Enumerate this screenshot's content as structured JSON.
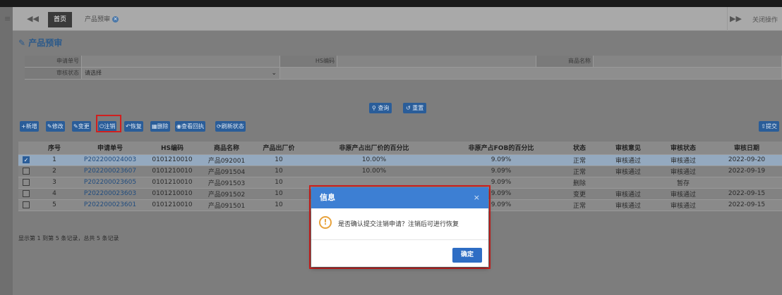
{
  "tabs": {
    "home": "首页",
    "active": "产品预审",
    "close_ops": "关闭操作"
  },
  "page": {
    "title": "产品预审"
  },
  "form": {
    "apply_no_label": "申请单号",
    "hs_label": "HS编码",
    "goods_name_label": "商品名称",
    "status_label": "审核状态",
    "status_value": "请选择",
    "query": "查询",
    "reset": "重置"
  },
  "toolbar": {
    "add": "新增",
    "edit": "修改",
    "change": "变更",
    "cancel": "注销",
    "restore": "恢复",
    "delete": "删除",
    "view_receipt": "查看回执",
    "refresh": "刷新状态",
    "submit": "提交"
  },
  "table": {
    "columns": [
      "序号",
      "申请单号",
      "HS编码",
      "商品名称",
      "产品出厂价",
      "非原产占出厂价的百分比",
      "非原产占FOB的百分比",
      "状态",
      "审核意见",
      "审核状态",
      "审核日期"
    ],
    "rows": [
      {
        "no": "1",
        "apply": "P202200024003",
        "hs": "0101210010",
        "name": "产品092001",
        "price": "10",
        "pct_ex": "10.00%",
        "pct_fob": "9.09%",
        "state": "正常",
        "opinion": "审核通过",
        "audit": "审核通过",
        "date": "2022-09-20",
        "checked": true
      },
      {
        "no": "2",
        "apply": "P202200023607",
        "hs": "0101210010",
        "name": "产品091504",
        "price": "10",
        "pct_ex": "10.00%",
        "pct_fob": "9.09%",
        "state": "正常",
        "opinion": "审核通过",
        "audit": "审核通过",
        "date": "2022-09-19",
        "checked": false
      },
      {
        "no": "3",
        "apply": "P202200023605",
        "hs": "0101210010",
        "name": "产品091503",
        "price": "10",
        "pct_ex": "",
        "pct_fob": "9.09%",
        "state": "删除",
        "opinion": "",
        "audit": "暂存",
        "date": "",
        "checked": false
      },
      {
        "no": "4",
        "apply": "P202200023603",
        "hs": "0101210010",
        "name": "产品091502",
        "price": "10",
        "pct_ex": "",
        "pct_fob": "9.09%",
        "state": "变更",
        "opinion": "审核通过",
        "audit": "审核通过",
        "date": "2022-09-15",
        "checked": false
      },
      {
        "no": "5",
        "apply": "P202200023601",
        "hs": "0101210010",
        "name": "产品091501",
        "price": "10",
        "pct_ex": "",
        "pct_fob": "9.09%",
        "state": "正常",
        "opinion": "审核通过",
        "audit": "审核通过",
        "date": "2022-09-15",
        "checked": false
      }
    ]
  },
  "footer": {
    "info": "显示第 1 到第 5 条记录，总共 5 条记录"
  },
  "dialog": {
    "title": "信息",
    "close": "×",
    "icon": "!",
    "message": "是否确认提交注销申请？注销后可进行恢复",
    "ok": "确定"
  }
}
